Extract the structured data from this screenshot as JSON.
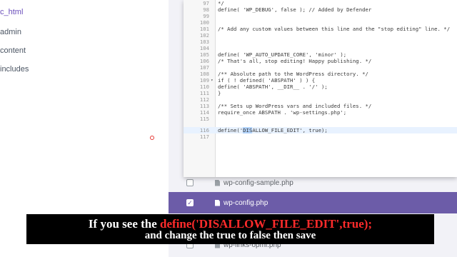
{
  "left_tree": {
    "items": [
      {
        "label": "c_html",
        "active": true
      },
      {
        "label": "admin",
        "active": false
      },
      {
        "label": "content",
        "active": false
      },
      {
        "label": "includes",
        "active": false
      }
    ]
  },
  "file_list": {
    "rows": [
      {
        "name": "wp-config-sample.php",
        "selected": false
      },
      {
        "name": "wp-config.php",
        "selected": true
      },
      {
        "name": "",
        "selected": false
      },
      {
        "name": "wp-links-opml.php",
        "selected": false
      }
    ]
  },
  "editor": {
    "lines": [
      {
        "n": "97",
        "code": "*/",
        "fold": ""
      },
      {
        "n": "98",
        "code": "define( 'WP_DEBUG', false ); // Added by Defender",
        "fold": ""
      },
      {
        "n": "99",
        "code": "",
        "fold": ""
      },
      {
        "n": "100",
        "code": "",
        "fold": ""
      },
      {
        "n": "101",
        "code": "/* Add any custom values between this line and the \"stop editing\" line. */",
        "fold": ""
      },
      {
        "n": "102",
        "code": "",
        "fold": ""
      },
      {
        "n": "103",
        "code": "",
        "fold": ""
      },
      {
        "n": "104",
        "code": "",
        "fold": ""
      },
      {
        "n": "105",
        "code": "define( 'WP_AUTO_UPDATE_CORE', 'minor' );",
        "fold": ""
      },
      {
        "n": "106",
        "code": "/* That's all, stop editing! Happy publishing. */",
        "fold": ""
      },
      {
        "n": "107",
        "code": "",
        "fold": ""
      },
      {
        "n": "108",
        "code": "/** Absolute path to the WordPress directory. */",
        "fold": ""
      },
      {
        "n": "109",
        "code": "if ( ! defined( 'ABSPATH' ) ) {",
        "fold": "▾"
      },
      {
        "n": "110",
        "code": "define( 'ABSPATH', __DIR__ . '/' );",
        "fold": ""
      },
      {
        "n": "111",
        "code": "}",
        "fold": ""
      },
      {
        "n": "112",
        "code": "",
        "fold": ""
      },
      {
        "n": "113",
        "code": "/** Sets up WordPress vars and included files. */",
        "fold": ""
      },
      {
        "n": "114",
        "code": "require_once ABSPATH . 'wp-settings.php';",
        "fold": ""
      },
      {
        "n": "115",
        "code": "",
        "fold": ""
      },
      {
        "n": "116",
        "code_pre": "define('",
        "code_sel": "DIS",
        "code_post": "ALLOW_FILE_EDIT', true);",
        "fold": "",
        "current": true
      },
      {
        "n": "117",
        "code": "",
        "fold": ""
      }
    ]
  },
  "subtitle": {
    "line1_prefix": "If you see the ",
    "line1_highlight": "define('DISALLOW_FILE_EDIT',true);",
    "line2": "and change the true to false then save"
  },
  "colors": {
    "accent": "#6c5ca8",
    "highlight_text": "#ff2b2b",
    "selection": "#b3d4fc"
  }
}
